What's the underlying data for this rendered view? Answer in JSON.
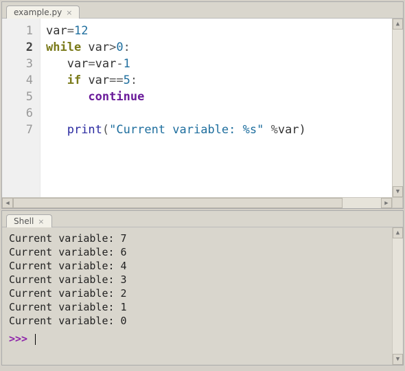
{
  "editor": {
    "tab_label": "example.py",
    "current_line": 2,
    "lines": [
      [
        {
          "t": "var",
          "c": ""
        },
        {
          "t": "=",
          "c": "op"
        },
        {
          "t": "12",
          "c": "num"
        }
      ],
      [
        {
          "t": "while",
          "c": "kw"
        },
        {
          "t": " var",
          "c": ""
        },
        {
          "t": ">",
          "c": "op"
        },
        {
          "t": "0",
          "c": "num"
        },
        {
          "t": ":",
          "c": "op"
        }
      ],
      [
        {
          "t": "   var",
          "c": ""
        },
        {
          "t": "=",
          "c": "op"
        },
        {
          "t": "var",
          "c": ""
        },
        {
          "t": "-",
          "c": "op"
        },
        {
          "t": "1",
          "c": "num"
        }
      ],
      [
        {
          "t": "   ",
          "c": ""
        },
        {
          "t": "if",
          "c": "kw"
        },
        {
          "t": " var",
          "c": ""
        },
        {
          "t": "==",
          "c": "op"
        },
        {
          "t": "5",
          "c": "num"
        },
        {
          "t": ":",
          "c": "op"
        }
      ],
      [
        {
          "t": "      ",
          "c": ""
        },
        {
          "t": "continue",
          "c": "kw2"
        }
      ],
      [],
      [
        {
          "t": "   ",
          "c": ""
        },
        {
          "t": "print",
          "c": "func"
        },
        {
          "t": "(",
          "c": "op"
        },
        {
          "t": "\"Current variable: %s\"",
          "c": "str"
        },
        {
          "t": " ",
          "c": ""
        },
        {
          "t": "%",
          "c": "op"
        },
        {
          "t": "var)",
          "c": ""
        }
      ]
    ]
  },
  "shell": {
    "tab_label": "Shell",
    "output": [
      "Current variable: 7",
      "Current variable: 6",
      "Current variable: 4",
      "Current variable: 3",
      "Current variable: 2",
      "Current variable: 1",
      "Current variable: 0"
    ],
    "prompt": ">>> "
  }
}
